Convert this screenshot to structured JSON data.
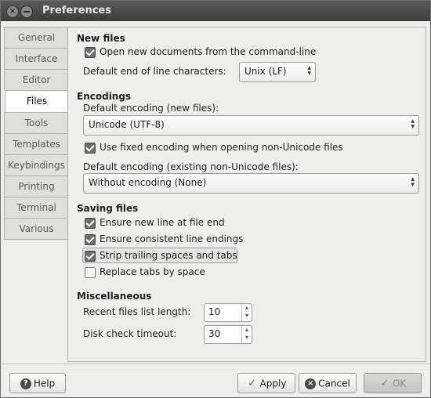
{
  "window": {
    "title": "Preferences"
  },
  "tabs": [
    "General",
    "Interface",
    "Editor",
    "Files",
    "Tools",
    "Templates",
    "Keybindings",
    "Printing",
    "Terminal",
    "Various"
  ],
  "active_tab": "Files",
  "new_files": {
    "heading": "New files",
    "open_cmdline_label": "Open new documents from the command-line",
    "open_cmdline_checked": true,
    "eol_label": "Default end of line characters:",
    "eol_value": "Unix (LF)"
  },
  "encodings": {
    "heading": "Encodings",
    "default_new_label": "Default encoding (new files):",
    "default_new_value": "Unicode (UTF-8)",
    "fixed_label": "Use fixed encoding when opening non-Unicode files",
    "fixed_checked": true,
    "existing_label": "Default encoding (existing non-Unicode files):",
    "existing_value": "Without encoding (None)"
  },
  "saving": {
    "heading": "Saving files",
    "items": [
      {
        "label": "Ensure new line at file end",
        "checked": true
      },
      {
        "label": "Ensure consistent line endings",
        "checked": true
      },
      {
        "label": "Strip trailing spaces and tabs",
        "checked": true
      },
      {
        "label": "Replace tabs by space",
        "checked": false
      }
    ]
  },
  "misc": {
    "heading": "Miscellaneous",
    "recent_label": "Recent files list length:",
    "recent_value": "10",
    "disk_label": "Disk check timeout:",
    "disk_value": "30"
  },
  "buttons": {
    "help": "Help",
    "apply": "Apply",
    "cancel": "Cancel",
    "ok": "OK"
  }
}
